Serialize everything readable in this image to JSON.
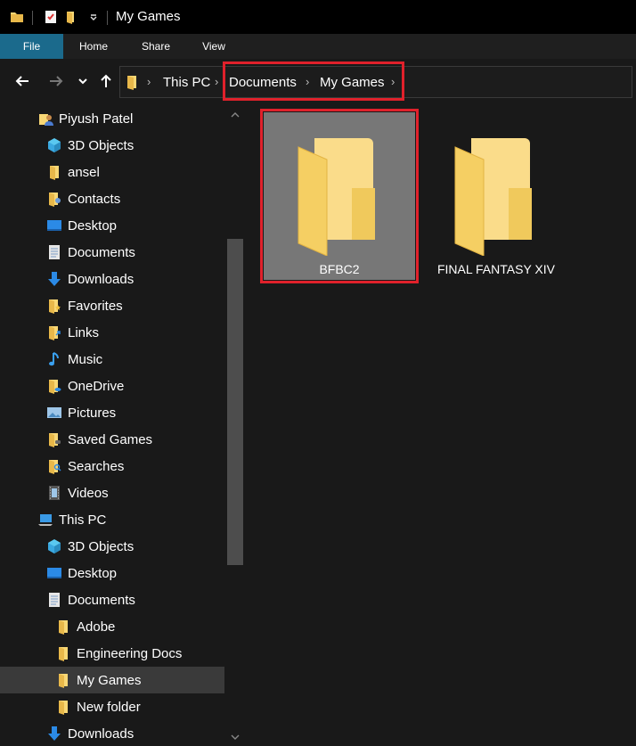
{
  "window": {
    "title": "My Games"
  },
  "ribbon": {
    "tabs": [
      "File",
      "Home",
      "Share",
      "View"
    ]
  },
  "address": {
    "crumbs": [
      "This PC",
      "Documents",
      "My Games"
    ]
  },
  "nav": {
    "items": [
      {
        "label": "Piyush Patel",
        "icon": "user-folder-icon"
      },
      {
        "label": "3D Objects",
        "icon": "cube-icon"
      },
      {
        "label": "ansel",
        "icon": "folder-icon"
      },
      {
        "label": "Contacts",
        "icon": "contacts-folder-icon"
      },
      {
        "label": "Desktop",
        "icon": "desktop-icon"
      },
      {
        "label": "Documents",
        "icon": "document-icon"
      },
      {
        "label": "Downloads",
        "icon": "download-icon"
      },
      {
        "label": "Favorites",
        "icon": "favorites-folder-icon"
      },
      {
        "label": "Links",
        "icon": "links-folder-icon"
      },
      {
        "label": "Music",
        "icon": "music-note-icon"
      },
      {
        "label": "OneDrive",
        "icon": "onedrive-folder-icon"
      },
      {
        "label": "Pictures",
        "icon": "pictures-icon"
      },
      {
        "label": "Saved Games",
        "icon": "saved-games-folder-icon"
      },
      {
        "label": "Searches",
        "icon": "search-folder-icon"
      },
      {
        "label": "Videos",
        "icon": "film-icon"
      },
      {
        "label": "This PC",
        "icon": "computer-icon"
      },
      {
        "label": "3D Objects",
        "icon": "cube-icon"
      },
      {
        "label": "Desktop",
        "icon": "desktop-icon"
      },
      {
        "label": "Documents",
        "icon": "document-icon"
      },
      {
        "label": "Adobe",
        "icon": "folder-icon"
      },
      {
        "label": "Engineering Docs",
        "icon": "folder-icon"
      },
      {
        "label": "My Games",
        "icon": "folder-icon"
      },
      {
        "label": "New folder",
        "icon": "folder-icon"
      },
      {
        "label": "Downloads",
        "icon": "download-icon"
      }
    ]
  },
  "content": {
    "folders": [
      {
        "name": "BFBC2",
        "selected": true
      },
      {
        "name": "FINAL FANTASY XIV",
        "selected": false
      }
    ]
  },
  "colors": {
    "accent": "#1b6a8c",
    "highlight": "#e0212b",
    "folder": "#f8d775"
  }
}
